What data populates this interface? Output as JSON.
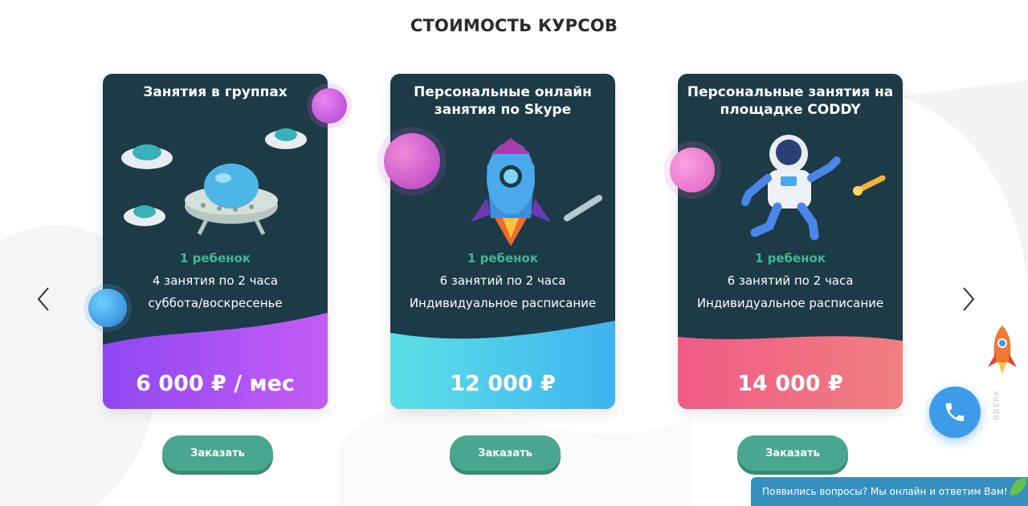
{
  "section": {
    "title": "СТОИМОСТЬ КУРСОВ"
  },
  "carousel": {
    "prev_icon": "chevron-left-icon",
    "next_icon": "chevron-right-icon"
  },
  "cards": [
    {
      "title": "Занятия в группах",
      "kids": "1 ребенок",
      "line1": "4 занятия по 2 часа",
      "line2": "суббота/воскресенье",
      "price": "6 000 ₽ / мес",
      "order": "Заказать",
      "accent": "#9b5cf0"
    },
    {
      "title": "Персональные онлайн занятия по Skype",
      "kids": "1 ребенок",
      "line1": "6 занятий по 2 часа",
      "line2": "Индивидуальное расписание",
      "price": "12 000 ₽",
      "order": "Заказать",
      "accent": "#4fd6e8"
    },
    {
      "title": "Персональные занятия на площадке CODDY",
      "kids": "1 ребенок",
      "line1": "6 занятий по 2 часа",
      "line2": "Индивидуальное расписание",
      "price": "14 000 ₽",
      "order": "Заказать",
      "accent": "#f05b86"
    }
  ],
  "widgets": {
    "phone_icon": "phone-icon",
    "up_label": "ВВЕРХ",
    "chat_text": "Появились вопросы? Мы онлайн и ответим Вам!"
  },
  "colors": {
    "card_bg": "#1d3a47",
    "kids_green": "#3dbb91",
    "button_green": "#4aa78f",
    "phone_blue": "#3d9be9",
    "chat_blue": "#3590bf"
  }
}
